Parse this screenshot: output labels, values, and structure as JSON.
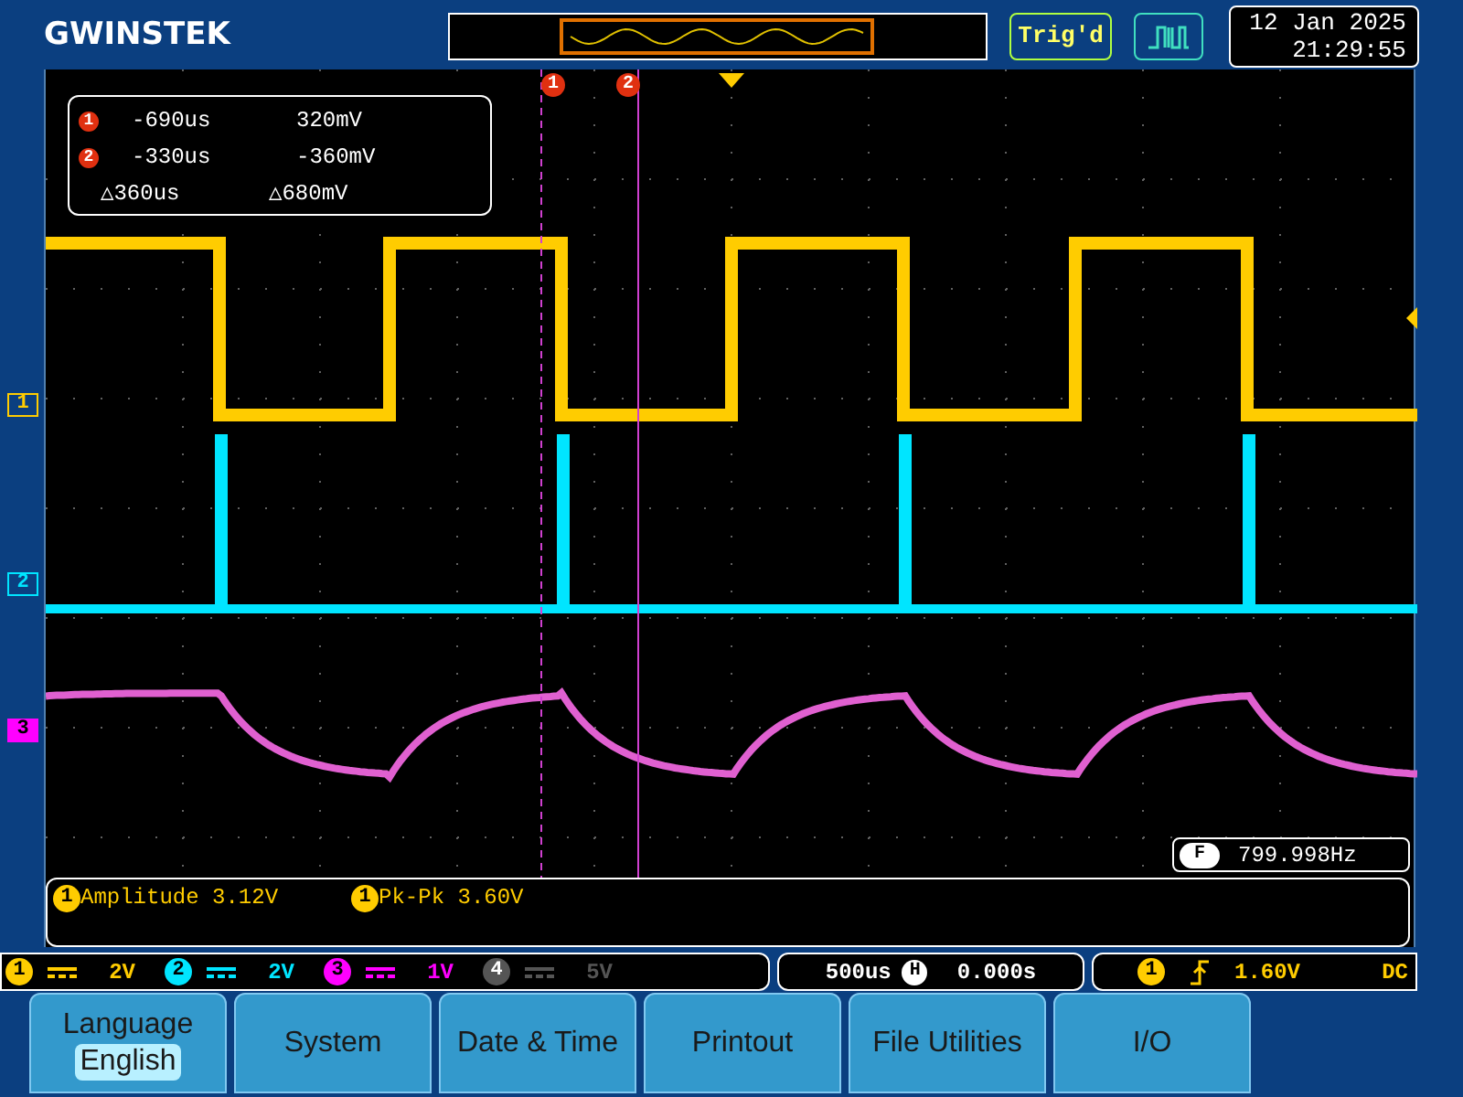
{
  "header": {
    "logo": "GWINSTEK",
    "trigger_status": "Trig'd",
    "date": "12 Jan 2025",
    "time": "21:29:55"
  },
  "cursor_readout": {
    "rows": [
      {
        "marker": "1",
        "time": "-690us",
        "voltage": "320mV"
      },
      {
        "marker": "2",
        "time": "-330us",
        "voltage": "-360mV"
      }
    ],
    "delta": {
      "symbol": "△",
      "time": "360us",
      "voltage": "680mV"
    }
  },
  "cursor_markers": [
    "1",
    "2"
  ],
  "channel_markers": [
    {
      "label": "1",
      "color": "#ffcc00"
    },
    {
      "label": "2",
      "color": "#00e5ff"
    },
    {
      "label": "3",
      "color": "#ff00ff"
    }
  ],
  "frequency": {
    "icon": "F",
    "value": "799.998Hz"
  },
  "measurements": [
    {
      "channel": "1",
      "text": "Amplitude 3.12V"
    },
    {
      "channel": "1",
      "text": "Pk-Pk 3.60V"
    }
  ],
  "channels": [
    {
      "number": "1",
      "scale": "2V",
      "color": "#ffcc00"
    },
    {
      "number": "2",
      "scale": "2V",
      "color": "#00e5ff"
    },
    {
      "number": "3",
      "scale": "1V",
      "color": "#ff00ff"
    },
    {
      "number": "4",
      "scale": "5V",
      "color": "#555555"
    }
  ],
  "timebase": {
    "scale": "500us",
    "icon": "H",
    "position": "0.000s"
  },
  "trigger": {
    "source": "1",
    "level": "1.60V",
    "coupling": "DC"
  },
  "menu": [
    {
      "label": "Language",
      "value": "English"
    },
    {
      "label": "System"
    },
    {
      "label": "Date & Time"
    },
    {
      "label": "Printout"
    },
    {
      "label": "File Utilities"
    },
    {
      "label": "I/O"
    }
  ]
}
